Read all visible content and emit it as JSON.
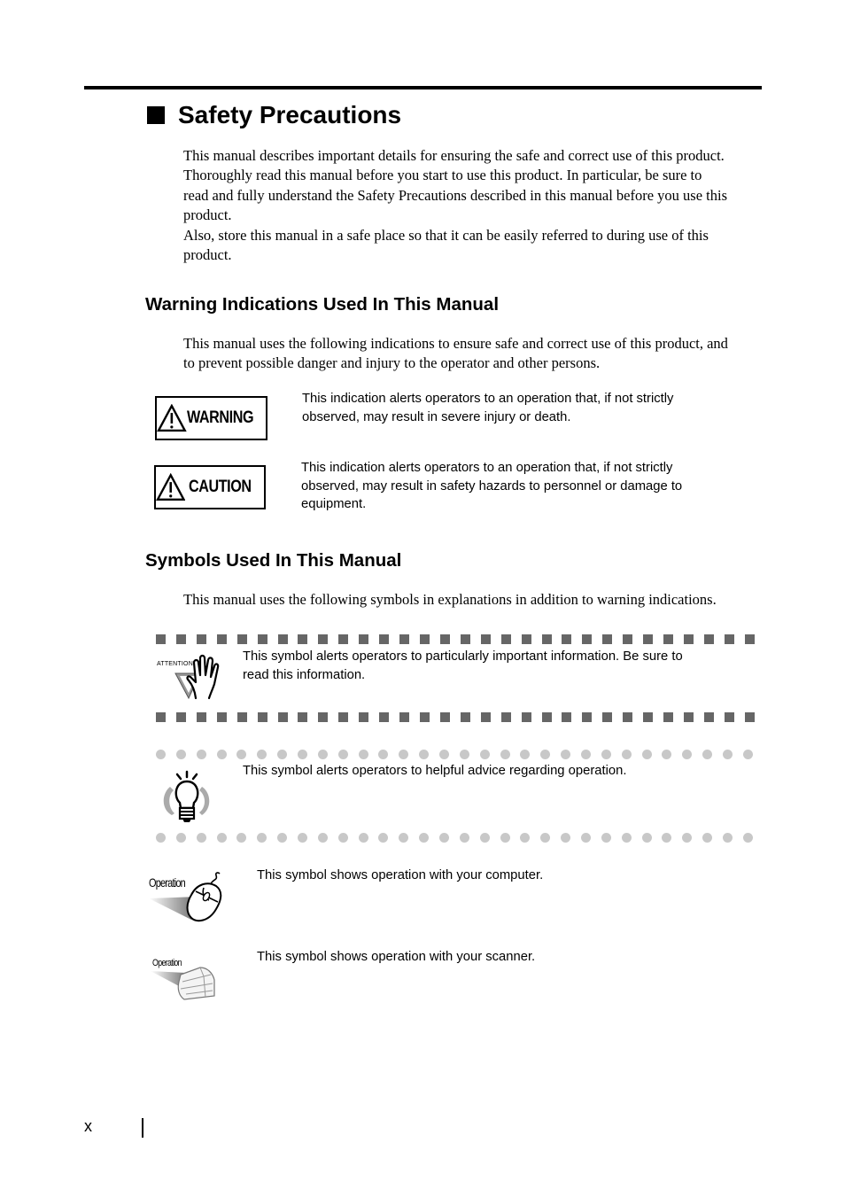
{
  "page": {
    "title": "Safety Precautions",
    "intro_lines": [
      "This manual describes important details for ensuring the safe and correct use of this product.",
      "Thoroughly read this manual before you start to use this product. In particular, be sure to",
      "read and fully understand the Safety Precautions described in this manual before you use this",
      "product.",
      "Also, store this manual in a safe place so that it can be easily referred to during use of this",
      "product."
    ],
    "page_number": "x"
  },
  "warning_section": {
    "heading": "Warning Indications Used In This Manual",
    "intro_lines": [
      "This manual uses the following indications to ensure safe and correct use of this product, and",
      "to prevent possible danger and injury to the operator and other persons."
    ],
    "items": [
      {
        "badge_label": "WARNING",
        "icon": "warning-triangle-icon",
        "text_lines": [
          "This indication alerts operators to an operation that, if not strictly",
          "observed, may result in severe injury or death."
        ]
      },
      {
        "badge_label": "CAUTION",
        "icon": "warning-triangle-icon",
        "text_lines": [
          "This indication alerts operators to an operation that, if not strictly",
          "observed, may result in safety hazards to personnel or damage to",
          "equipment."
        ]
      }
    ]
  },
  "symbols_section": {
    "heading": "Symbols Used In This Manual",
    "intro": "This manual uses the following symbols in explanations in addition to warning indications.",
    "attention": {
      "icon": "attention-hand-icon",
      "icon_label": "ATTENTION",
      "text_lines": [
        "This symbol alerts operators to particularly important information. Be sure to",
        "read this information."
      ]
    },
    "hint": {
      "icon": "lightbulb-icon",
      "text": "This symbol alerts operators to helpful advice regarding operation."
    },
    "operation_computer": {
      "icon": "mouse-icon",
      "icon_label": "Operation",
      "text": "This symbol shows operation with your computer."
    },
    "operation_scanner": {
      "icon": "scanner-icon",
      "icon_label": "Operation",
      "text": "This symbol shows operation with your scanner."
    }
  },
  "colors": {
    "square_divider": "#666666",
    "dot_divider": "#c8c8c8",
    "text": "#000000"
  }
}
